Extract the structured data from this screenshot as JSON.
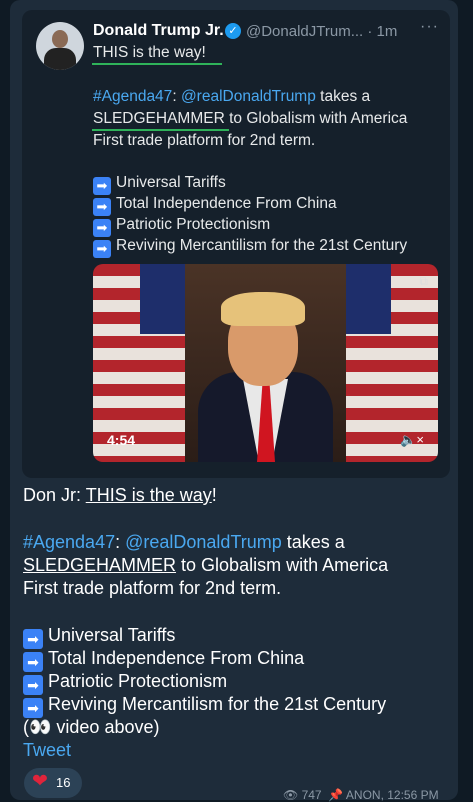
{
  "embed": {
    "name": "Donald Trump Jr.",
    "handle": "@DonaldJTrum...",
    "time": "· 1m",
    "more": "···",
    "line1": "THIS is the way!",
    "hashtag": "#Agenda47",
    "colon": ":",
    "mention": "@realDonaldTrump",
    "line2_rest": " takes a",
    "line3_word": "SLEDGEHAMMER",
    "line3_rest": " to Globalism with America",
    "line4": "First trade platform for 2nd term.",
    "bullets": [
      "Universal Tariffs",
      "Total Independence From China",
      "Patriotic Protectionism",
      "Reviving Mercantilism for the 21st Century"
    ],
    "video_duration": "4:54"
  },
  "message": {
    "prefix": "Don Jr: ",
    "quote": "THIS is the way",
    "bang": "!",
    "hashtag": "#Agenda47",
    "colon": ": ",
    "mention": "@realDonaldTrump",
    "line2_rest": " takes a",
    "line3_word": "SLEDGEHAMMER",
    "line3_rest": " to Globalism with America",
    "line4": "First trade platform for 2nd term.",
    "bullets": [
      "Universal Tariffs",
      "Total Independence From China",
      "Patriotic Protectionism",
      "Reviving Mercantilism for the 21st Century"
    ],
    "video_note": "(👀 video above)",
    "link": "Tweet"
  },
  "reaction": {
    "emoji": "❤",
    "count": "16"
  },
  "meta": {
    "views": "747",
    "author": "ANON",
    "time": "12:56 PM"
  },
  "colors": {
    "accent": "#4aa8f0",
    "highlight": "#2fb35a",
    "bubble": "#1e2c3a"
  }
}
